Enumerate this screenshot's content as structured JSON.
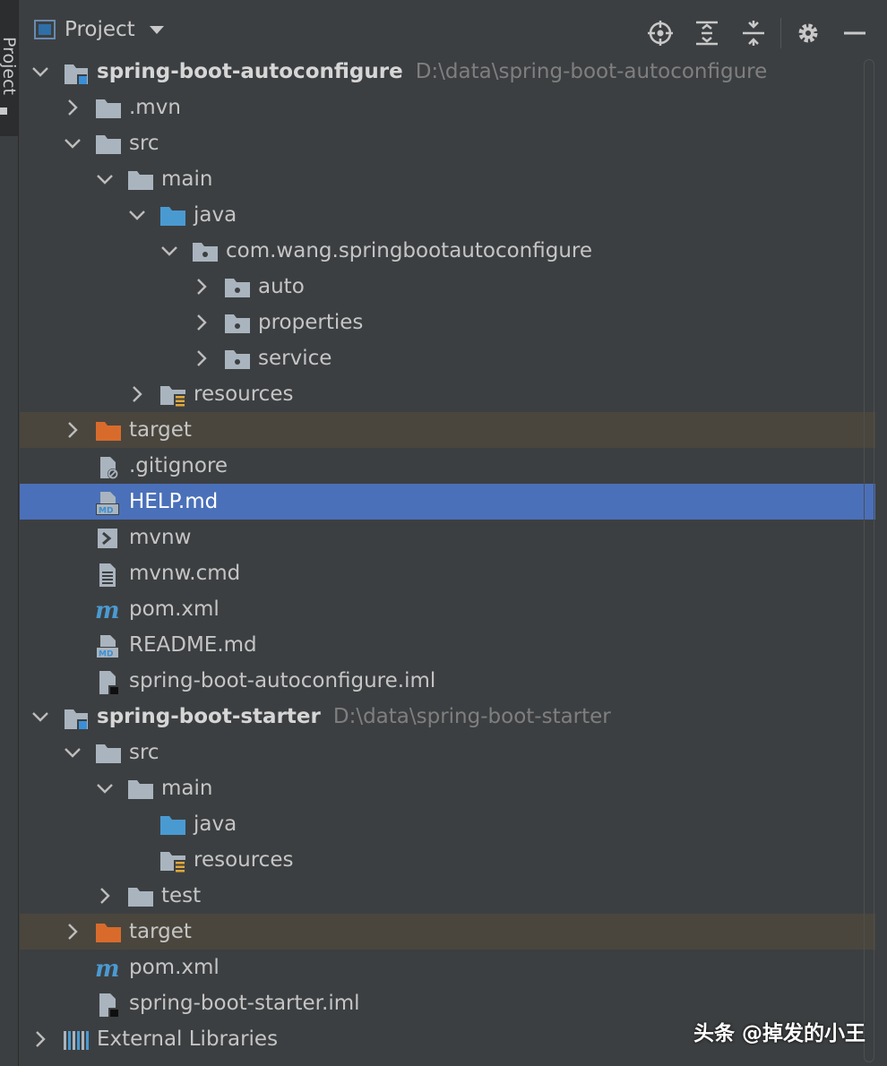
{
  "sidebar": {
    "tab_label": "Project"
  },
  "header": {
    "title": "Project",
    "toolbar": [
      "locate-icon",
      "expand-all-icon",
      "collapse-all-icon",
      "gear-icon",
      "minimize-icon"
    ]
  },
  "tree": [
    {
      "label": "spring-boot-autoconfigure",
      "path": "D:\\data\\spring-boot-autoconfigure",
      "icon": "module-icon",
      "indent": 0,
      "chevron": "down",
      "bold": true
    },
    {
      "label": ".mvn",
      "icon": "folder-icon",
      "indent": 1,
      "chevron": "right"
    },
    {
      "label": "src",
      "icon": "folder-icon",
      "indent": 1,
      "chevron": "down"
    },
    {
      "label": "main",
      "icon": "folder-icon",
      "indent": 2,
      "chevron": "down"
    },
    {
      "label": "java",
      "icon": "source-folder-icon",
      "indent": 3,
      "chevron": "down"
    },
    {
      "label": "com.wang.springbootautoconfigure",
      "icon": "package-icon",
      "indent": 4,
      "chevron": "down"
    },
    {
      "label": "auto",
      "icon": "package-icon",
      "indent": 5,
      "chevron": "right"
    },
    {
      "label": "properties",
      "icon": "package-icon",
      "indent": 5,
      "chevron": "right"
    },
    {
      "label": "service",
      "icon": "package-icon",
      "indent": 5,
      "chevron": "right"
    },
    {
      "label": "resources",
      "icon": "resources-folder-icon",
      "indent": 3,
      "chevron": "right"
    },
    {
      "label": "target",
      "icon": "excluded-folder-icon",
      "indent": 1,
      "chevron": "right",
      "highlight": "target"
    },
    {
      "label": ".gitignore",
      "icon": "ignored-file-icon",
      "indent": 1,
      "chevron": "none"
    },
    {
      "label": "HELP.md",
      "icon": "markdown-file-icon",
      "indent": 1,
      "chevron": "none",
      "selected": true
    },
    {
      "label": "mvnw",
      "icon": "shell-script-icon",
      "indent": 1,
      "chevron": "none"
    },
    {
      "label": "mvnw.cmd",
      "icon": "text-file-icon",
      "indent": 1,
      "chevron": "none"
    },
    {
      "label": "pom.xml",
      "icon": "maven-icon",
      "indent": 1,
      "chevron": "none"
    },
    {
      "label": "README.md",
      "icon": "markdown-file-icon",
      "indent": 1,
      "chevron": "none"
    },
    {
      "label": "spring-boot-autoconfigure.iml",
      "icon": "iml-file-icon",
      "indent": 1,
      "chevron": "none"
    },
    {
      "label": "spring-boot-starter",
      "path": "D:\\data\\spring-boot-starter",
      "icon": "module-icon",
      "indent": 0,
      "chevron": "down",
      "bold": true
    },
    {
      "label": "src",
      "icon": "folder-icon",
      "indent": 1,
      "chevron": "down"
    },
    {
      "label": "main",
      "icon": "folder-icon",
      "indent": 2,
      "chevron": "down"
    },
    {
      "label": "java",
      "icon": "source-folder-icon",
      "indent": 3,
      "chevron": "none"
    },
    {
      "label": "resources",
      "icon": "resources-folder-icon",
      "indent": 3,
      "chevron": "none"
    },
    {
      "label": "test",
      "icon": "folder-icon",
      "indent": 2,
      "chevron": "right"
    },
    {
      "label": "target",
      "icon": "excluded-folder-icon",
      "indent": 1,
      "chevron": "right",
      "highlight": "target"
    },
    {
      "label": "pom.xml",
      "icon": "maven-icon",
      "indent": 1,
      "chevron": "none"
    },
    {
      "label": "spring-boot-starter.iml",
      "icon": "iml-file-icon",
      "indent": 1,
      "chevron": "none"
    },
    {
      "label": "External Libraries",
      "icon": "libraries-icon",
      "indent": 0,
      "chevron": "right"
    }
  ],
  "watermark": "头条 @掉发的小王",
  "colors": {
    "background": "#3c3f41",
    "selection": "#4a70b9",
    "excluded_row": "#4a463d",
    "folder": "#a9b4be",
    "source_folder": "#4a9ad2",
    "excluded_folder": "#d86b2c",
    "path_text": "#7f7f7f"
  }
}
